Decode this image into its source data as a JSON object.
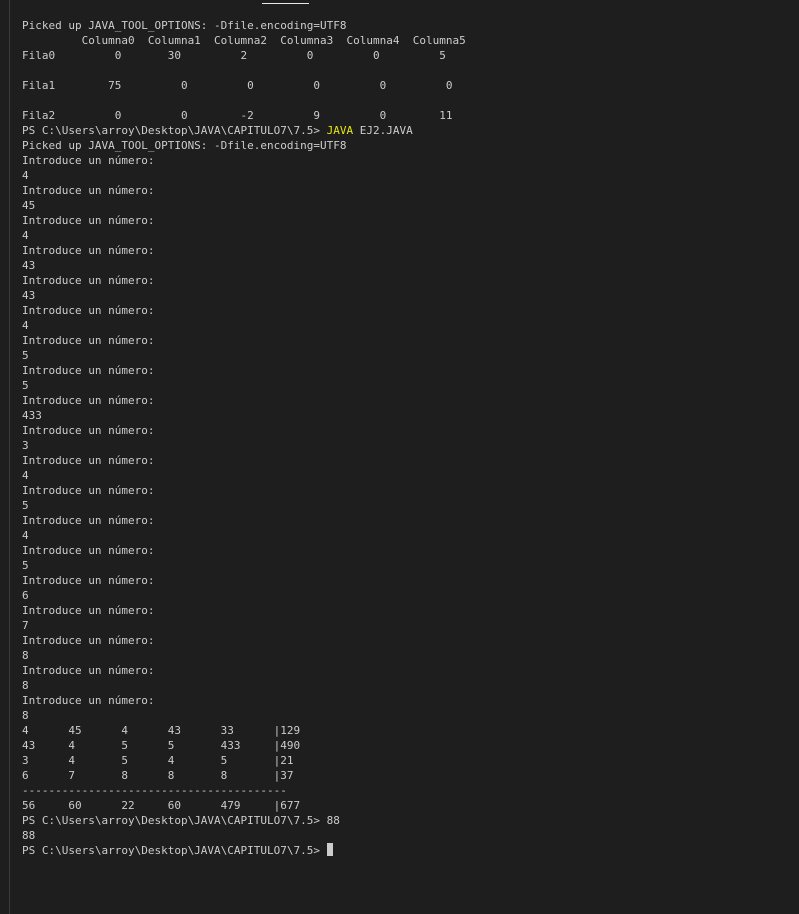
{
  "terminal": {
    "lines": [
      "Picked up JAVA_TOOL_OPTIONS: -Dfile.encoding=UTF8",
      "         Columna0  Columna1  Columna2  Columna3  Columna4  Columna5",
      "Fila0         0       30         2         0         0         5",
      "",
      "Fila1        75         0         0         0         0         0",
      "",
      "Fila2         0         0        -2         9         0        11",
      "PS C:\\Users\\arroy\\Desktop\\JAVA\\CAPITULO7\\7.5> ",
      "Picked up JAVA_TOOL_OPTIONS: -Dfile.encoding=UTF8",
      "Introduce un número:",
      "4",
      "Introduce un número:",
      "45",
      "Introduce un número:",
      "4",
      "Introduce un número:",
      "43",
      "Introduce un número:",
      "43",
      "Introduce un número:",
      "4",
      "Introduce un número:",
      "5",
      "Introduce un número:",
      "5",
      "Introduce un número:",
      "433",
      "Introduce un número:",
      "3",
      "Introduce un número:",
      "4",
      "Introduce un número:",
      "5",
      "Introduce un número:",
      "4",
      "Introduce un número:",
      "5",
      "Introduce un número:",
      "6",
      "Introduce un número:",
      "7",
      "Introduce un número:",
      "8",
      "Introduce un número:",
      "8",
      "Introduce un número:",
      "8",
      "4      45      4      43      33      |129",
      "43     4       5      5       433     |490",
      "3      4       5      4       5       |21",
      "6      7       8      8       8       |37",
      "----------------------------------------",
      "56     60      22     60      479     |677",
      "PS C:\\Users\\arroy\\Desktop\\JAVA\\CAPITULO7\\7.5> 88",
      "88",
      "PS C:\\Users\\arroy\\Desktop\\JAVA\\CAPITULO7\\7.5> "
    ],
    "command_keyword": "JAVA",
    "command_args": " EJ2.JAVA"
  }
}
